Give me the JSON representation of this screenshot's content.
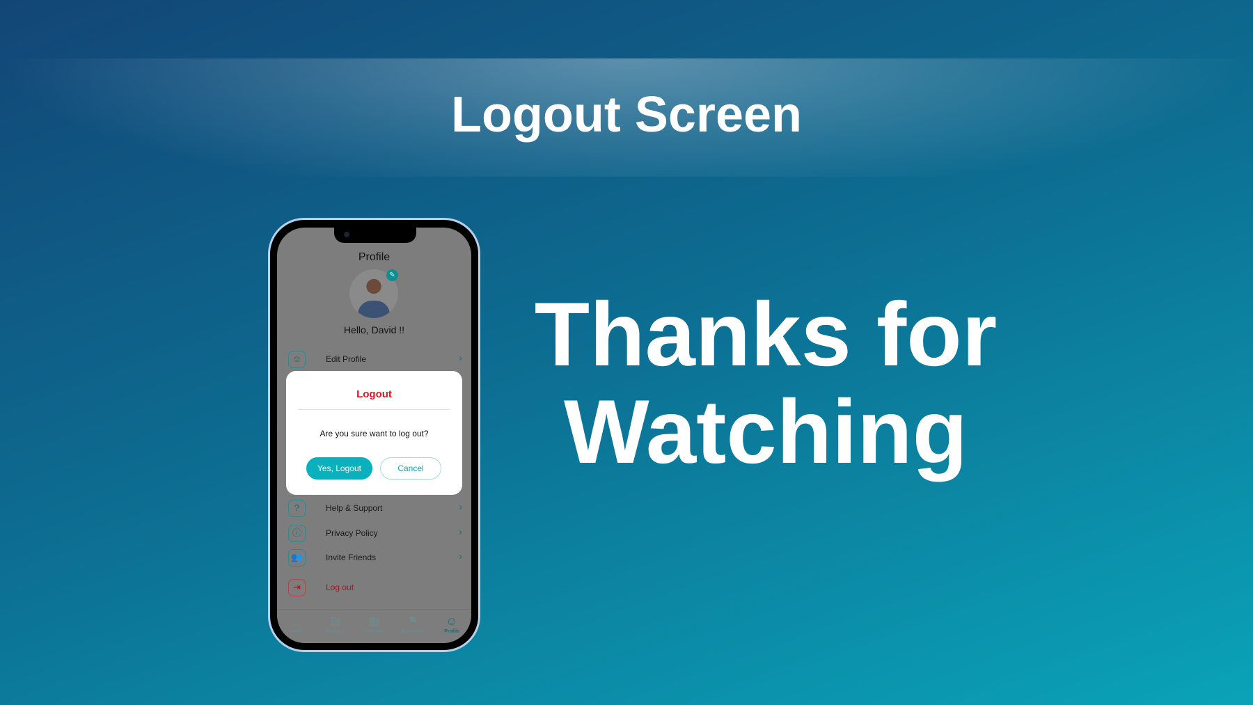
{
  "slide": {
    "title": "Logout Screen",
    "thanks_line1": "Thanks for",
    "thanks_line2": "Watching"
  },
  "app": {
    "header": "Profile",
    "greeting": "Hello, David !!",
    "menu": [
      {
        "label": "Edit Profile",
        "icon": "user-icon"
      },
      {
        "label": "Help & Support",
        "icon": "help-icon"
      },
      {
        "label": "Privacy Policy",
        "icon": "info-icon"
      },
      {
        "label": "Invite Friends",
        "icon": "users-icon"
      }
    ],
    "logout_label": "Log out",
    "nav": [
      {
        "label": "Home",
        "icon": "home-icon"
      },
      {
        "label": "Bookings",
        "icon": "bookings-icon"
      },
      {
        "label": "Calender",
        "icon": "calendar-icon"
      },
      {
        "label": "Bookmark",
        "icon": "bookmark-icon"
      },
      {
        "label": "Profile",
        "icon": "profile-icon",
        "active": true
      }
    ]
  },
  "modal": {
    "title": "Logout",
    "question": "Are you sure want to log out?",
    "confirm": "Yes, Logout",
    "cancel": "Cancel"
  },
  "colors": {
    "accent": "#0bb0bd",
    "danger": "#e0141c"
  }
}
